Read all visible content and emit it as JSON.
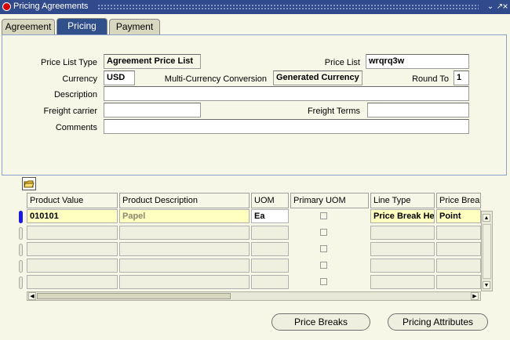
{
  "window": {
    "title": "Pricing Agreements"
  },
  "tabs": [
    {
      "label": "Agreement"
    },
    {
      "label": "Pricing"
    },
    {
      "label": "Payment"
    }
  ],
  "form": {
    "price_list_type": {
      "label": "Price List Type",
      "value": "Agreement Price List"
    },
    "price_list": {
      "label": "Price List",
      "value": "wrqrq3w"
    },
    "currency": {
      "label": "Currency",
      "value": "USD"
    },
    "multi_currency": {
      "label": "Multi-Currency Conversion",
      "value": "Generated Currency"
    },
    "round_to": {
      "label": "Round To",
      "value": "1"
    },
    "description": {
      "label": "Description",
      "value": ""
    },
    "freight_carrier": {
      "label": "Freight carrier",
      "value": ""
    },
    "freight_terms": {
      "label": "Freight Terms",
      "value": ""
    },
    "comments": {
      "label": "Comments",
      "value": ""
    }
  },
  "grid": {
    "columns": [
      "Product Value",
      "Product Description",
      "UOM",
      "Primary UOM",
      "Line Type",
      "Price Break"
    ],
    "rows": [
      {
        "product_value": "010101",
        "product_description": "Papel",
        "uom": "Ea",
        "primary_uom": false,
        "line_type": "Price Break He",
        "price_break": "Point"
      }
    ]
  },
  "buttons": {
    "price_breaks": "Price Breaks",
    "pricing_attributes": "Pricing Attributes"
  }
}
